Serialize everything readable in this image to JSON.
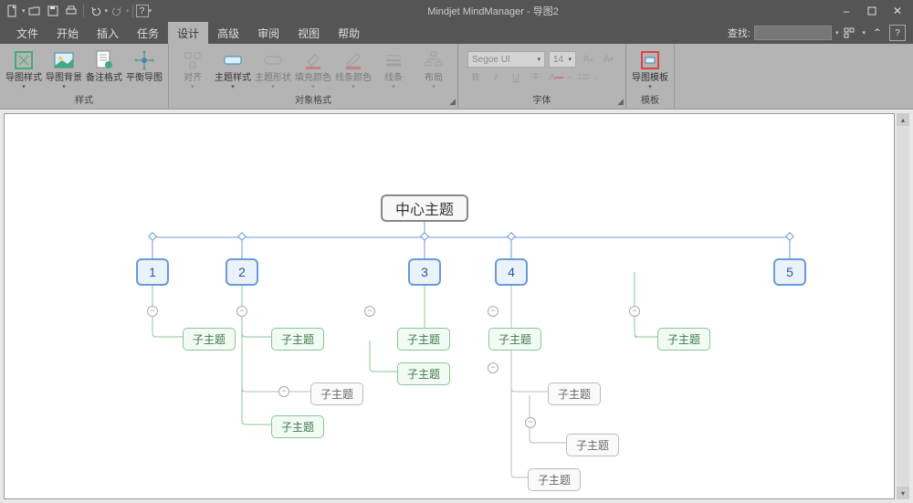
{
  "title": "Mindjet MindManager - 导图2",
  "menus": {
    "file": "文件",
    "start": "开始",
    "insert": "插入",
    "task": "任务",
    "design": "设计",
    "advanced": "高级",
    "review": "审阅",
    "view": "视图",
    "help": "帮助"
  },
  "search_label": "查找:",
  "ribbon": {
    "styles_group": "样式",
    "map_style": "导图样式",
    "map_bg": "导图背景",
    "note_format": "备注格式",
    "balance_map": "平衡导图",
    "obj_group": "对象格式",
    "align": "对齐",
    "topic_style": "主题样式",
    "topic_shape": "主题形状",
    "fill_color": "填充颜色",
    "line_color": "线条颜色",
    "lines": "线条",
    "layout": "布局",
    "font_group": "字体",
    "font_name": "Segoe UI",
    "font_size": "14",
    "tmpl_group": "模板",
    "map_tmpl": "导图模板"
  },
  "map": {
    "central": "中心主题",
    "m1": "1",
    "m2": "2",
    "m3": "3",
    "m4": "4",
    "m5": "5",
    "sub": "子主题"
  }
}
